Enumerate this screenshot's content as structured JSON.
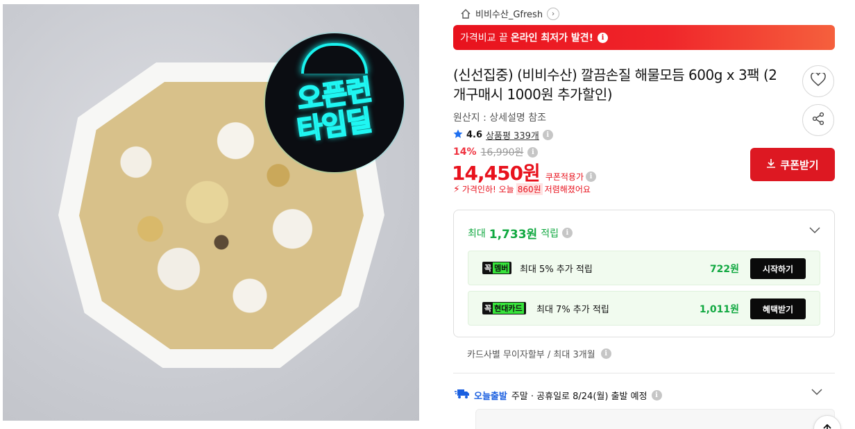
{
  "product_image": {
    "badge_line1": "오픈런",
    "badge_line2": "타임딜"
  },
  "store": {
    "name": "비비수산_Gfresh"
  },
  "promo_banner": {
    "prefix": "가격비교 끝",
    "highlight": "온라인 최저가 발견!"
  },
  "product": {
    "title": "(신선집중) (비비수산) 깔끔손질 해물모듬 600g x 3팩 (2개구매시 1000원 추가할인)",
    "origin": "원산지 : 상세설명 참조",
    "rating": "4.6",
    "reviews": "상품평 339개",
    "discount_rate": "14%",
    "original_price": "16,990원",
    "price": "14,450원",
    "coupon_applied": "쿠폰적용가",
    "price_drop_prefix": "가격인하! 오늘",
    "price_drop_amount": "860원",
    "price_drop_suffix": "저렴해졌어요"
  },
  "coupon_button": {
    "label": "쿠폰받기"
  },
  "rewards": {
    "head_prefix": "최대",
    "head_amount": "1,733원",
    "head_suffix": "적립",
    "items": [
      {
        "logo_k": "꼭",
        "logo_n": "멤버",
        "text": "최대 5% 추가 적립",
        "amount": "722원",
        "button": "시작하기"
      },
      {
        "logo_k": "꼭",
        "logo_n": "현대카드",
        "text": "최대 7% 추가 적립",
        "amount": "1,011원",
        "button": "혜택받기"
      }
    ]
  },
  "installment": {
    "text": "카드사별 무이자할부 / 최대 3개월"
  },
  "delivery": {
    "label": "오늘출발",
    "text": "주말 · 공휴일로 8/24(월) 출발 예정"
  },
  "colors": {
    "accent_red": "#e8121d",
    "reward_green": "#10a840",
    "delivery_blue": "#1a5fe0"
  }
}
